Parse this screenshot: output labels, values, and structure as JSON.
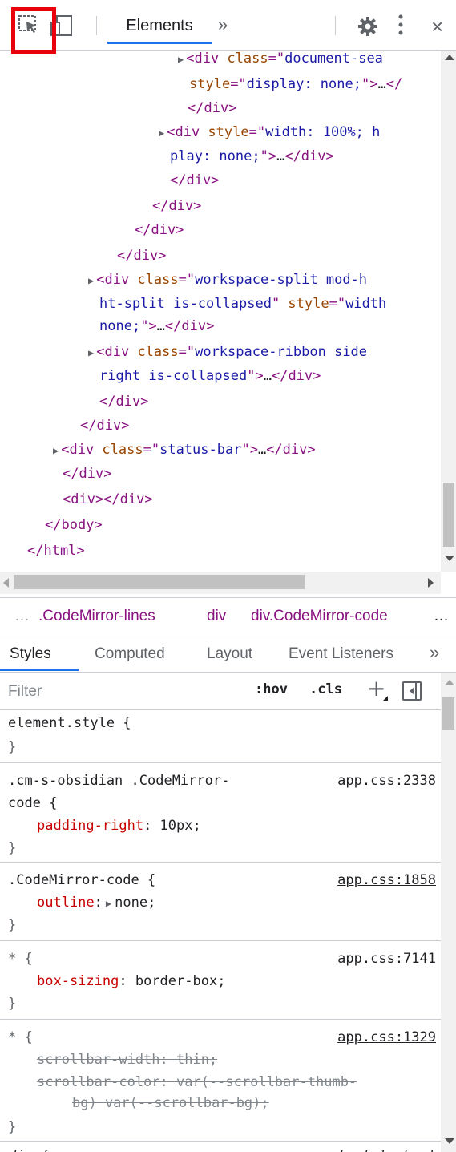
{
  "toolbar": {
    "tab_elements": "Elements",
    "more_tabs": "»",
    "close": "×",
    "icons": [
      "inspect-element-icon",
      "device-toggle-icon",
      "settings-gear-icon",
      "kebab-menu-icon",
      "close-icon"
    ],
    "highlight_color": "#e8000b",
    "accent_color": "#1a73e8"
  },
  "tree": {
    "lines": [
      {
        "t": "▶",
        "c": [
          [
            "tag",
            "<div "
          ],
          [
            "attr",
            "class"
          ],
          [
            "tag",
            "=\""
          ],
          [
            "val",
            "document-sea"
          ]
        ]
      },
      {
        "c": [
          [
            "attr",
            "style"
          ],
          [
            "tag",
            "=\""
          ],
          [
            "val",
            "display: none;"
          ],
          [
            "tag",
            "\">"
          ],
          [
            "txt",
            "…"
          ],
          [
            "tag",
            "</"
          ]
        ]
      },
      {
        "c": [
          [
            "tag",
            "</div>"
          ]
        ]
      },
      {
        "t": "▶",
        "c": [
          [
            "tag",
            "<div "
          ],
          [
            "attr",
            "style"
          ],
          [
            "tag",
            "=\""
          ],
          [
            "val",
            "width: 100%; h"
          ]
        ]
      },
      {
        "c": [
          [
            "val",
            "play: none;"
          ],
          [
            "tag",
            "\">"
          ],
          [
            "txt",
            "…"
          ],
          [
            "tag",
            "</div>"
          ]
        ]
      },
      {
        "c": [
          [
            "tag",
            "</div>"
          ]
        ]
      },
      {
        "c": [
          [
            "tag",
            "</div>"
          ]
        ]
      },
      {
        "c": [
          [
            "tag",
            "</div>"
          ]
        ]
      },
      {
        "c": [
          [
            "tag",
            "</div>"
          ]
        ]
      },
      {
        "t": "▶",
        "c": [
          [
            "tag",
            "<div "
          ],
          [
            "attr",
            "class"
          ],
          [
            "tag",
            "=\""
          ],
          [
            "val",
            "workspace-split mod-h"
          ]
        ]
      },
      {
        "c": [
          [
            "val",
            "ht-split is-collapsed"
          ],
          [
            "tag",
            "\" "
          ],
          [
            "attr",
            "style"
          ],
          [
            "tag",
            "=\""
          ],
          [
            "val",
            "width"
          ]
        ]
      },
      {
        "c": [
          [
            "val",
            "none;"
          ],
          [
            "tag",
            "\">"
          ],
          [
            "txt",
            "…"
          ],
          [
            "tag",
            "</div>"
          ]
        ]
      },
      {
        "t": "▶",
        "c": [
          [
            "tag",
            "<div "
          ],
          [
            "attr",
            "class"
          ],
          [
            "tag",
            "=\""
          ],
          [
            "val",
            "workspace-ribbon side"
          ]
        ]
      },
      {
        "c": [
          [
            "val",
            "right is-collapsed"
          ],
          [
            "tag",
            "\">"
          ],
          [
            "txt",
            "…"
          ],
          [
            "tag",
            "</div>"
          ]
        ]
      },
      {
        "c": [
          [
            "tag",
            "</div>"
          ]
        ]
      },
      {
        "c": [
          [
            "tag",
            "</div>"
          ]
        ]
      },
      {
        "t": "▶",
        "c": [
          [
            "tag",
            "<div "
          ],
          [
            "attr",
            "class"
          ],
          [
            "tag",
            "=\""
          ],
          [
            "val",
            "status-bar"
          ],
          [
            "tag",
            "\">"
          ],
          [
            "txt",
            "…"
          ],
          [
            "tag",
            "</div>"
          ]
        ]
      },
      {
        "c": [
          [
            "tag",
            "</div>"
          ]
        ]
      },
      {
        "c": [
          [
            "tag",
            "<div></div>"
          ]
        ]
      },
      {
        "c": [
          [
            "tag",
            "</body>"
          ]
        ]
      },
      {
        "c": [
          [
            "tag",
            "</html>"
          ]
        ]
      }
    ]
  },
  "breadcrumbs": {
    "ellipsis": "…",
    "item1": "‎.CodeMirror-lines",
    "item2": "div",
    "item3": "div.CodeMirror-code",
    "more": "…"
  },
  "subtabs": {
    "styles": "Styles",
    "computed": "Computed",
    "layout": "Layout",
    "event_listeners": "Event Listeners",
    "more": "»"
  },
  "filter": {
    "placeholder": "Filter",
    "hov": ":hov",
    "cls": ".cls",
    "plus": "+"
  },
  "styles": {
    "element_style": {
      "selector": "element.style {",
      "close": "}"
    },
    "rules": [
      {
        "selector1": ".cm-s-obsidian .CodeMirror-",
        "selector2": "code {",
        "source": "app.css:2338",
        "prop": "padding-right",
        "value": "10px;"
      },
      {
        "selector1": ".CodeMirror-code {",
        "source": "app.css:1858",
        "prop": "outline",
        "value": "none;"
      },
      {
        "selector1": "* {",
        "source": "app.css:7141",
        "prop": "box-sizing",
        "value": "border-box;"
      },
      {
        "selector1": "* {",
        "source": "app.css:1329",
        "strike1": "scrollbar-width: thin;",
        "strike2": "scrollbar-color: var(--scrollbar-thumb-",
        "strike3": "bg) var(--scrollbar-bg);"
      }
    ],
    "ua": {
      "selector": "div {",
      "source": "user agent stylesheet"
    },
    "close": "}"
  }
}
